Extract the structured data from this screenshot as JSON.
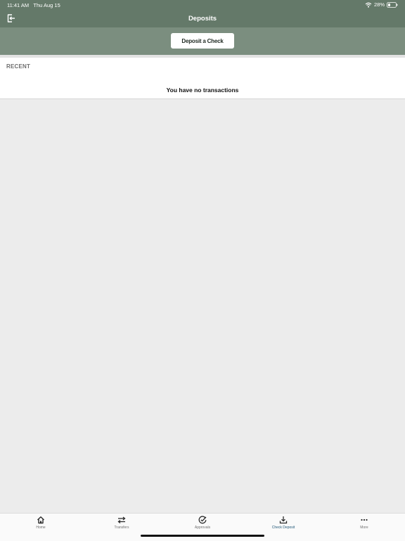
{
  "status_bar": {
    "time": "11:41 AM",
    "date": "Thu Aug 15",
    "battery": "28%",
    "icons": [
      "wifi-icon",
      "battery-icon"
    ]
  },
  "nav": {
    "title": "Deposits",
    "left_icon": "logout-icon"
  },
  "actions": {
    "deposit_label": "Deposit a Check"
  },
  "recent": {
    "header": "RECENT",
    "empty_message": "You have no transactions"
  },
  "tabs": [
    {
      "label": "Home",
      "icon": "home-icon",
      "active": false
    },
    {
      "label": "Transfers",
      "icon": "transfers-icon",
      "active": false
    },
    {
      "label": "Approvals",
      "icon": "approvals-icon",
      "active": false
    },
    {
      "label": "Check Deposit",
      "icon": "check-deposit-icon",
      "active": true
    },
    {
      "label": "More",
      "icon": "more-icon",
      "active": false
    }
  ],
  "colors": {
    "header": "#647969",
    "action_band": "#7b8e7f",
    "active_tab": "#235a7a",
    "background": "#ececec"
  }
}
